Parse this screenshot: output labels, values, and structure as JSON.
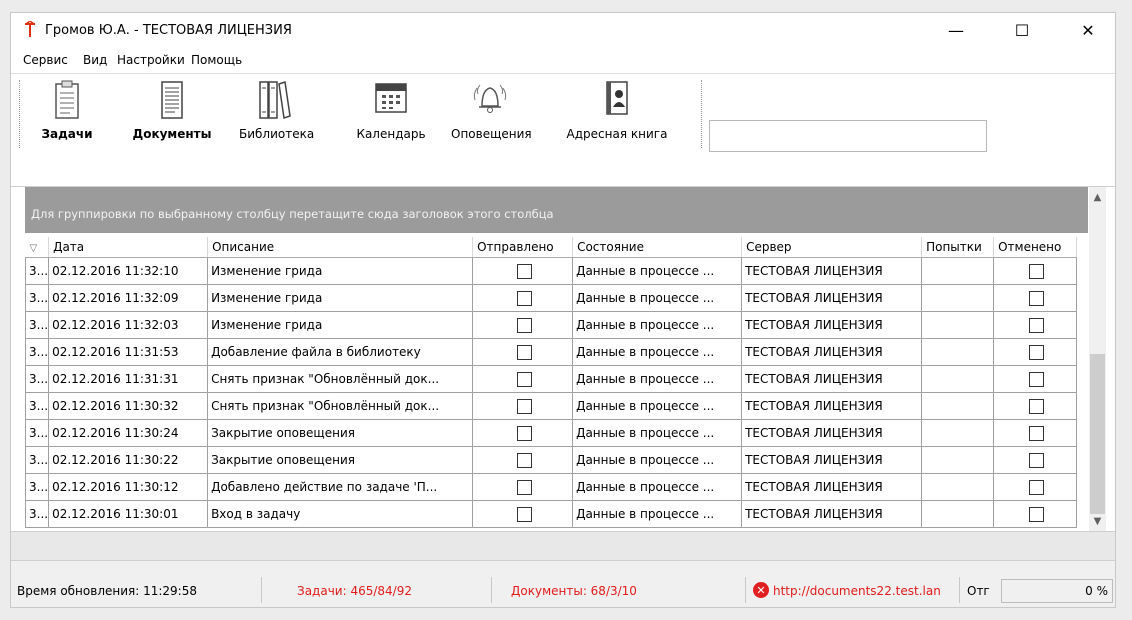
{
  "window": {
    "title": "Громов Ю.А. - ТЕСТОВАЯ ЛИЦЕНЗИЯ",
    "minimize": "—",
    "maximize": "☐",
    "close": "✕"
  },
  "menu": [
    "Сервис",
    "Вид",
    "Настройки",
    "Помощь"
  ],
  "toolbar": {
    "buttons": [
      {
        "label": "Задачи",
        "icon": "clipboard-icon",
        "bold": true
      },
      {
        "label": "Документы",
        "icon": "document-icon",
        "bold": true
      },
      {
        "label": "Библиотека",
        "icon": "books-icon",
        "bold": false
      },
      {
        "label": "Календарь",
        "icon": "calendar-icon",
        "bold": false
      },
      {
        "label": "Оповещения",
        "icon": "bell-icon",
        "bold": false
      },
      {
        "label": "Адресная книга",
        "icon": "address-book-icon",
        "bold": false
      }
    ],
    "search_value": ""
  },
  "grid": {
    "group_hint": "Для группировки по выбранному столбцу перетащите сюда заголовок этого столбца",
    "columns": [
      "",
      "Дата",
      "Описание",
      "Отправлено",
      "Состояние",
      "Сервер",
      "Попытки",
      "Отменено"
    ],
    "filter_glyph": "▽",
    "rows": [
      {
        "id": "3...",
        "date": "02.12.2016 11:32:10",
        "desc": "Изменение грида",
        "sent": false,
        "state": "Данные в процессе ...",
        "server": "ТЕСТОВАЯ ЛИЦЕНЗИЯ",
        "attempts": "",
        "cancelled": false
      },
      {
        "id": "3...",
        "date": "02.12.2016 11:32:09",
        "desc": "Изменение грида",
        "sent": false,
        "state": "Данные в процессе ...",
        "server": "ТЕСТОВАЯ ЛИЦЕНЗИЯ",
        "attempts": "",
        "cancelled": false
      },
      {
        "id": "3...",
        "date": "02.12.2016 11:32:03",
        "desc": "Изменение грида",
        "sent": false,
        "state": "Данные в процессе ...",
        "server": "ТЕСТОВАЯ ЛИЦЕНЗИЯ",
        "attempts": "",
        "cancelled": false
      },
      {
        "id": "3...",
        "date": "02.12.2016 11:31:53",
        "desc": "Добавление файла в библиотеку",
        "sent": false,
        "state": "Данные в процессе ...",
        "server": "ТЕСТОВАЯ ЛИЦЕНЗИЯ",
        "attempts": "",
        "cancelled": false
      },
      {
        "id": "3...",
        "date": "02.12.2016 11:31:31",
        "desc": "Снять признак \"Обновлённый док...",
        "sent": false,
        "state": "Данные в процессе ...",
        "server": "ТЕСТОВАЯ ЛИЦЕНЗИЯ",
        "attempts": "",
        "cancelled": false
      },
      {
        "id": "3...",
        "date": "02.12.2016 11:30:32",
        "desc": "Снять признак \"Обновлённый док...",
        "sent": false,
        "state": "Данные в процессе ...",
        "server": "ТЕСТОВАЯ ЛИЦЕНЗИЯ",
        "attempts": "",
        "cancelled": false
      },
      {
        "id": "3...",
        "date": "02.12.2016 11:30:24",
        "desc": "Закрытие оповещения",
        "sent": false,
        "state": "Данные в процессе ...",
        "server": "ТЕСТОВАЯ ЛИЦЕНЗИЯ",
        "attempts": "",
        "cancelled": false
      },
      {
        "id": "3...",
        "date": "02.12.2016 11:30:22",
        "desc": "Закрытие оповещения",
        "sent": false,
        "state": "Данные в процессе ...",
        "server": "ТЕСТОВАЯ ЛИЦЕНЗИЯ",
        "attempts": "",
        "cancelled": false
      },
      {
        "id": "3...",
        "date": "02.12.2016 11:30:12",
        "desc": "Добавлено действие по задаче 'П...",
        "sent": false,
        "state": "Данные в процессе ...",
        "server": "ТЕСТОВАЯ ЛИЦЕНЗИЯ",
        "attempts": "",
        "cancelled": false
      },
      {
        "id": "3...",
        "date": "02.12.2016 11:30:01",
        "desc": "Вход в задачу",
        "sent": false,
        "state": "Данные в процессе ...",
        "server": "ТЕСТОВАЯ ЛИЦЕНЗИЯ",
        "attempts": "",
        "cancelled": false
      }
    ]
  },
  "status": {
    "update_time": "Время обновления: 11:29:58",
    "tasks": "Задачи: 465/84/92",
    "documents": "Документы: 68/3/10",
    "url": "http://documents22.test.lan",
    "otr": "Отг",
    "progress": "0 %",
    "progress_value": 0,
    "alert_color": "#e21b1b"
  }
}
